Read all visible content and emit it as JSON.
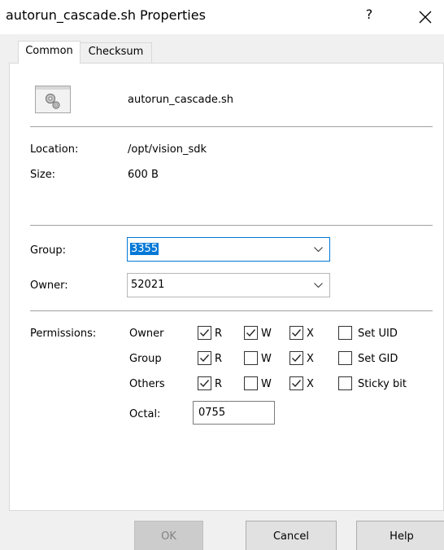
{
  "window": {
    "title": "autorun_cascade.sh Properties",
    "help_label": "?"
  },
  "tabs": [
    {
      "label": "Common",
      "active": true
    },
    {
      "label": "Checksum",
      "active": false
    }
  ],
  "file": {
    "name": "autorun_cascade.sh",
    "icon": "gears-file-icon"
  },
  "info": {
    "location_label": "Location:",
    "location_value": "/opt/vision_sdk",
    "size_label": "Size:",
    "size_value": "600 B"
  },
  "ownership": {
    "group_label": "Group:",
    "group_value": "3355",
    "owner_label": "Owner:",
    "owner_value": "52021"
  },
  "permissions": {
    "label": "Permissions:",
    "rows": [
      {
        "label": "Owner",
        "r": true,
        "w": true,
        "x": true,
        "special_label": "Set UID",
        "special": false
      },
      {
        "label": "Group",
        "r": true,
        "w": false,
        "x": true,
        "special_label": "Set GID",
        "special": false
      },
      {
        "label": "Others",
        "r": true,
        "w": false,
        "x": true,
        "special_label": "Sticky bit",
        "special": false
      }
    ],
    "r_label": "R",
    "w_label": "W",
    "x_label": "X",
    "octal_label": "Octal:",
    "octal_value": "0755"
  },
  "buttons": {
    "ok": "OK",
    "cancel": "Cancel",
    "help": "Help"
  }
}
